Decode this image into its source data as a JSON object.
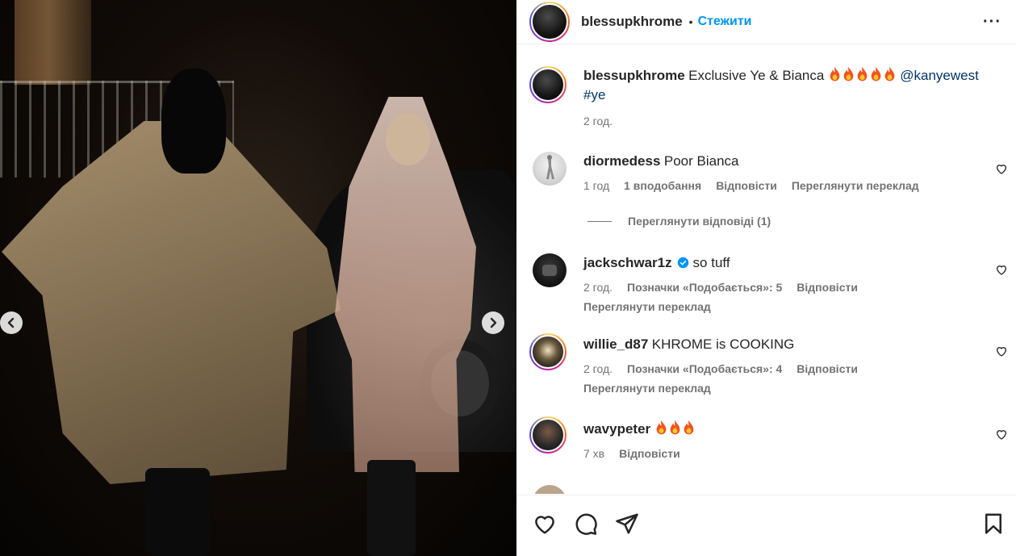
{
  "post": {
    "username": "blessupkhrome",
    "follow_label": "Стежити",
    "more_icon": "more-horizontal-icon",
    "caption_text": "Exclusive Ye & Bianca",
    "caption_fire_count": 5,
    "caption_mention": "@kanyewest",
    "caption_hashtag": "#ye",
    "caption_time": "2 год."
  },
  "comments": [
    {
      "username": "diormedess",
      "text": "Poor Bianca",
      "time": "1 год",
      "likes": "1 вподобання",
      "reply": "Відповісти",
      "translate": "Переглянути переклад"
    },
    {
      "username": "jackschwar1z",
      "verified": true,
      "text": "so tuff",
      "time": "2 год.",
      "likes": "Позначки «Подобається»: 5",
      "reply": "Відповісти",
      "translate": "Переглянути переклад"
    },
    {
      "username": "willie_d87",
      "text": "KHROME is COOKING",
      "time": "2 год.",
      "likes": "Позначки «Подобається»: 4",
      "reply": "Відповісти",
      "translate": "Переглянути переклад"
    },
    {
      "username": "wavypeter",
      "text": "",
      "fire_count": 3,
      "time": "7 хв",
      "reply": "Відповісти"
    }
  ],
  "view_replies": "Переглянути відповіді (1)",
  "colors": {
    "link": "#00376b",
    "follow": "#0095f6",
    "meta": "#737373"
  },
  "icons": {
    "like": "heart-icon",
    "comment": "comment-icon",
    "share": "send-icon",
    "save": "bookmark-icon",
    "prev": "chevron-left-icon",
    "next": "chevron-right-icon"
  }
}
